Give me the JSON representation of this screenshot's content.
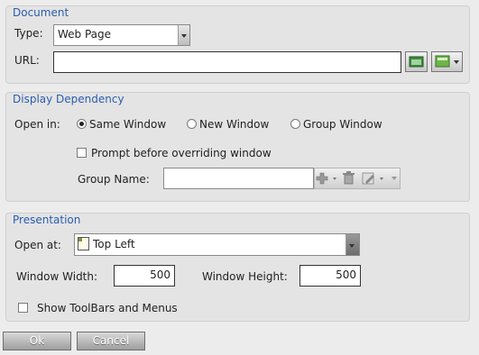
{
  "document": {
    "title": "Document",
    "type_label": "Type:",
    "type_value": "Web Page",
    "url_label": "URL:",
    "url_value": ""
  },
  "display_dependency": {
    "title": "Display Dependency",
    "open_in_label": "Open in:",
    "options": [
      {
        "label": "Same Window",
        "selected": true
      },
      {
        "label": "New Window",
        "selected": false
      },
      {
        "label": "Group Window",
        "selected": false
      }
    ],
    "prompt_label": "Prompt before overriding window",
    "prompt_checked": false,
    "group_name_label": "Group Name:",
    "group_name_value": ""
  },
  "presentation": {
    "title": "Presentation",
    "open_at_label": "Open at:",
    "open_at_value": "Top Left",
    "width_label": "Window Width:",
    "width_value": "500",
    "height_label": "Window Height:",
    "height_value": "500",
    "toolbars_label": "Show ToolBars and Menus",
    "toolbars_checked": false
  },
  "buttons": {
    "ok": "Ok",
    "cancel": "Cancel"
  },
  "colors": {
    "section_title": "#2a5db0",
    "background": "#ececec",
    "panel": "#e4e4e4"
  }
}
